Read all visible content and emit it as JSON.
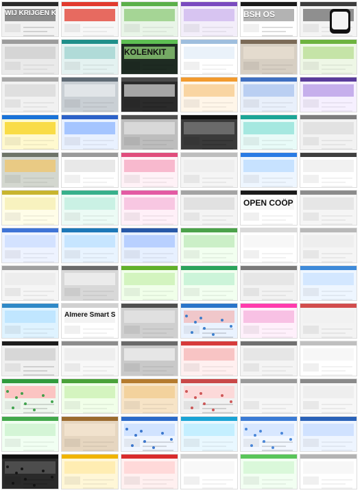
{
  "grid": {
    "columns": 6,
    "rows": 13,
    "background": "#ffffff",
    "tiles": [
      {
        "label": "WIJ KRIJGEN KIPPEN",
        "theme": "dark",
        "bg": "#f2f2f2",
        "bar": "#2b2b2b",
        "accent": "#6b6b6b"
      },
      {
        "label": "",
        "theme": "red",
        "bg": "#f7f7f7",
        "bar": "#e23b2e",
        "accent": "#e23b2e"
      },
      {
        "label": "",
        "theme": "green",
        "bg": "#e9f5e8",
        "bar": "#5bb04a",
        "accent": "#8ec97a"
      },
      {
        "label": "",
        "theme": "purple",
        "bg": "#f3eefa",
        "bar": "#7a4bbf",
        "accent": "#cdb6ee"
      },
      {
        "label": "BSH OS",
        "theme": "dark",
        "bg": "#ffffff",
        "bar": "#1a1a1a",
        "accent": "#9a9a9a"
      },
      {
        "label": "",
        "theme": "mobile",
        "bg": "#f4f4f4",
        "bar": "#3d3d3d",
        "accent": "#6d6d6d"
      },
      {
        "label": "",
        "theme": "gray",
        "bg": "#eaeaea",
        "bar": "#9c9c9c",
        "accent": "#c2c2c2"
      },
      {
        "label": "",
        "theme": "teal",
        "bg": "#e4f2f1",
        "bar": "#1f8f8a",
        "accent": "#9fd3cf"
      },
      {
        "label": "KOLENKIT",
        "theme": "green",
        "bg": "#1e2b22",
        "bar": "#5dbf52",
        "accent": "#93d67b"
      },
      {
        "label": "",
        "theme": "white",
        "bg": "#ffffff",
        "bar": "#9ebede",
        "accent": "#d8e8f5"
      },
      {
        "label": "",
        "theme": "photo",
        "bg": "#d7cfc3",
        "bar": "#7b6a57",
        "accent": "#e8dfd2"
      },
      {
        "label": "",
        "theme": "green",
        "bg": "#eef7e6",
        "bar": "#6db33f",
        "accent": "#b7de92"
      },
      {
        "label": "",
        "theme": "gray",
        "bg": "#f1f1f1",
        "bar": "#a7a7a7",
        "accent": "#cfcfcf"
      },
      {
        "label": "",
        "theme": "photo",
        "bg": "#c9cfd4",
        "bar": "#5f6b75",
        "accent": "#e8ecef"
      },
      {
        "label": "",
        "theme": "dark",
        "bg": "#2b2b2b",
        "bar": "#4a4a4a",
        "accent": "#d0d0d0"
      },
      {
        "label": "",
        "theme": "orange",
        "bg": "#fff6e9",
        "bar": "#f29a2e",
        "accent": "#f7c98a"
      },
      {
        "label": "",
        "theme": "blue",
        "bg": "#e9f0fb",
        "bar": "#3f6fc1",
        "accent": "#a9c4ef"
      },
      {
        "label": "",
        "theme": "purple",
        "bg": "#f6f0ff",
        "bar": "#5a3c9b",
        "accent": "#b59ae5"
      },
      {
        "label": "",
        "theme": "yellow",
        "bg": "#fff9cf",
        "bar": "#1a73d8",
        "accent": "#f7d21a"
      },
      {
        "label": "",
        "theme": "blue",
        "bg": "#e9f1ff",
        "bar": "#2c62c8",
        "accent": "#8db6ff"
      },
      {
        "label": "",
        "theme": "photo",
        "bg": "#bdbdbd",
        "bar": "#4e4e4e",
        "accent": "#e2e2e2"
      },
      {
        "label": "",
        "theme": "dark",
        "bg": "#3a3a3a",
        "bar": "#111111",
        "accent": "#7b7b7b"
      },
      {
        "label": "",
        "theme": "teal",
        "bg": "#e8fbf8",
        "bar": "#1ca596",
        "accent": "#8fe2d8"
      },
      {
        "label": "",
        "theme": "gray",
        "bg": "#f2f2f2",
        "bar": "#7d7d7d",
        "accent": "#d6d6d6"
      },
      {
        "label": "",
        "theme": "photo",
        "bg": "#d3d7cf",
        "bar": "#6e7468",
        "accent": "#f0c56b"
      },
      {
        "label": "",
        "theme": "white",
        "bg": "#ffffff",
        "bar": "#9a9a9a",
        "accent": "#d5d5d5"
      },
      {
        "label": "",
        "theme": "pink",
        "bg": "#fff2f7",
        "bar": "#e04c7c",
        "accent": "#f6a5c0"
      },
      {
        "label": "",
        "theme": "gray",
        "bg": "#f5f5f5",
        "bar": "#bdbdbd",
        "accent": "#e7e7e7"
      },
      {
        "label": "",
        "theme": "blue",
        "bg": "#eef6ff",
        "bar": "#2a7be4",
        "accent": "#b9dbff"
      },
      {
        "label": "",
        "theme": "white",
        "bg": "#ffffff",
        "bar": "#3f3f3f",
        "accent": "#e6e6e6"
      },
      {
        "label": "",
        "theme": "yellow",
        "bg": "#fffde8",
        "bar": "#c8b42e",
        "accent": "#f5eeb2"
      },
      {
        "label": "",
        "theme": "teal",
        "bg": "#ecfbf5",
        "bar": "#37b08b",
        "accent": "#bfeede"
      },
      {
        "label": "",
        "theme": "pink",
        "bg": "#fff0f8",
        "bar": "#e35aa3",
        "accent": "#f5b9db"
      },
      {
        "label": "",
        "theme": "gray",
        "bg": "#f4f4f4",
        "bar": "#a3a3a3",
        "accent": "#d1d1d1"
      },
      {
        "label": "OPEN COÖP",
        "theme": "white",
        "bg": "#ffffff",
        "bar": "#1a1a1a",
        "accent": "#f0f0f0"
      },
      {
        "label": "",
        "theme": "gray",
        "bg": "#f5f5f5",
        "bar": "#8b8b8b",
        "accent": "#d8d8d8"
      },
      {
        "label": "",
        "theme": "blue",
        "bg": "#eef3ff",
        "bar": "#3f74d6",
        "accent": "#c9dcff"
      },
      {
        "label": "",
        "theme": "blue",
        "bg": "#e9f4ff",
        "bar": "#1d78b8",
        "accent": "#b9e0ff"
      },
      {
        "label": "",
        "theme": "blue",
        "bg": "#e7f0ff",
        "bar": "#2859a8",
        "accent": "#a8c6ff"
      },
      {
        "label": "",
        "theme": "green",
        "bg": "#f2fff0",
        "bar": "#4ba24a",
        "accent": "#bde9b9"
      },
      {
        "label": "",
        "theme": "white",
        "bg": "#ffffff",
        "bar": "#d9d9d9",
        "accent": "#f1f1f1"
      },
      {
        "label": "",
        "theme": "gray",
        "bg": "#f5f5f5",
        "bar": "#b8b8b8",
        "accent": "#e8e8e8"
      },
      {
        "label": "",
        "theme": "gray",
        "bg": "#f5f5f5",
        "bar": "#9f9f9f",
        "accent": "#e5e5e5"
      },
      {
        "label": "",
        "theme": "photo",
        "bg": "#d8d8d8",
        "bar": "#6a6a6a",
        "accent": "#f2f2f2"
      },
      {
        "label": "",
        "theme": "green",
        "bg": "#f0ffe9",
        "bar": "#61b02a",
        "accent": "#c9f0b0"
      },
      {
        "label": "",
        "theme": "green",
        "bg": "#f2fff0",
        "bar": "#2ba35b",
        "accent": "#bff0d2"
      },
      {
        "label": "",
        "theme": "gray",
        "bg": "#f2f2f2",
        "bar": "#7a7a7a",
        "accent": "#dcdcdc"
      },
      {
        "label": "",
        "theme": "blue",
        "bg": "#eef6ff",
        "bar": "#3e8ad9",
        "accent": "#c9e2ff"
      },
      {
        "label": "",
        "theme": "blue",
        "bg": "#dff3ff",
        "bar": "#2f89c7",
        "accent": "#b6e2ff"
      },
      {
        "label": "Almere Smart Society",
        "theme": "white",
        "bg": "#ffffff",
        "bar": "#d0d0d0",
        "accent": "#eaeaea"
      },
      {
        "label": "",
        "theme": "photo",
        "bg": "#cfcfcf",
        "bar": "#4f4f4f",
        "accent": "#e5e5e5"
      },
      {
        "label": "",
        "theme": "map",
        "bg": "#eaf3ff",
        "bar": "#2a74c9",
        "accent": "#f2b8b8"
      },
      {
        "label": "",
        "theme": "pink",
        "bg": "#fff0fb",
        "bar": "#ff3cad",
        "accent": "#f6b2dc"
      },
      {
        "label": "",
        "theme": "photo",
        "bg": "#f3f3f3",
        "bar": "#d24d4d",
        "accent": "#f0f0f0"
      },
      {
        "label": "",
        "theme": "dark",
        "bg": "#f0f0f0",
        "bar": "#1c1c1c",
        "accent": "#cfcfcf"
      },
      {
        "label": "",
        "theme": "gray",
        "bg": "#f8f8f8",
        "bar": "#8c8c8c",
        "accent": "#e6e6e6"
      },
      {
        "label": "",
        "theme": "photo",
        "bg": "#c9c9c9",
        "bar": "#6a6a6a",
        "accent": "#efefef"
      },
      {
        "label": "",
        "theme": "red",
        "bg": "#fff0f0",
        "bar": "#d63a3a",
        "accent": "#f6b6b6"
      },
      {
        "label": "",
        "theme": "gray",
        "bg": "#f4f4f4",
        "bar": "#707070",
        "accent": "#dadada"
      },
      {
        "label": "",
        "theme": "white",
        "bg": "#ffffff",
        "bar": "#bfbfbf",
        "accent": "#f1f1f1"
      },
      {
        "label": "",
        "theme": "map",
        "bg": "#eef7ee",
        "bar": "#2f9b3d",
        "accent": "#ffb3b3"
      },
      {
        "label": "",
        "theme": "green",
        "bg": "#f1ffe9",
        "bar": "#4aa23a",
        "accent": "#c9f0b0"
      },
      {
        "label": "",
        "theme": "photo",
        "bg": "#f7e4c7",
        "bar": "#b57b2e",
        "accent": "#f2cc8f"
      },
      {
        "label": "",
        "theme": "map",
        "bg": "#f1f1f1",
        "bar": "#c94848",
        "accent": "#ffd0d0"
      },
      {
        "label": "",
        "theme": "gray",
        "bg": "#f6f6f6",
        "bar": "#9a9a9a",
        "accent": "#e9e9e9"
      },
      {
        "label": "",
        "theme": "gray",
        "bg": "#f7f7f7",
        "bar": "#8a8a8a",
        "accent": "#e8e8e8"
      },
      {
        "label": "",
        "theme": "green",
        "bg": "#f1fff2",
        "bar": "#42a84b",
        "accent": "#c9f1cc"
      },
      {
        "label": "",
        "theme": "photo",
        "bg": "#e6d6c0",
        "bar": "#9b6b2e",
        "accent": "#f4e6d2"
      },
      {
        "label": "",
        "theme": "map",
        "bg": "#f0f6ff",
        "bar": "#2a6ac9",
        "accent": "#c7dcff"
      },
      {
        "label": "",
        "theme": "blue",
        "bg": "#e9f8ff",
        "bar": "#1aa3d5",
        "accent": "#b7ecff"
      },
      {
        "label": "",
        "theme": "map",
        "bg": "#f2f7ff",
        "bar": "#3a7bd5",
        "accent": "#cfe2ff"
      },
      {
        "label": "",
        "theme": "blue",
        "bg": "#eef5ff",
        "bar": "#2a62b8",
        "accent": "#c6dbff"
      },
      {
        "label": "",
        "theme": "map",
        "bg": "#2a2a2a",
        "bar": "#111111",
        "accent": "#5a5a5a"
      },
      {
        "label": "",
        "theme": "yellow",
        "bg": "#fff7d7",
        "bar": "#f0b400",
        "accent": "#ffe9a6"
      },
      {
        "label": "",
        "theme": "red",
        "bg": "#fff0f0",
        "bar": "#d92c2c",
        "accent": "#ffd1d1"
      },
      {
        "label": "",
        "theme": "white",
        "bg": "#ffffff",
        "bar": "#cfcfcf",
        "accent": "#f2f2f2"
      },
      {
        "label": "",
        "theme": "green",
        "bg": "#f2fff2",
        "bar": "#5ac55a",
        "accent": "#d2f6d2"
      },
      {
        "label": "",
        "theme": "white",
        "bg": "#ffffff",
        "bar": "#b3b3b3",
        "accent": "#f0f0f0"
      }
    ]
  }
}
